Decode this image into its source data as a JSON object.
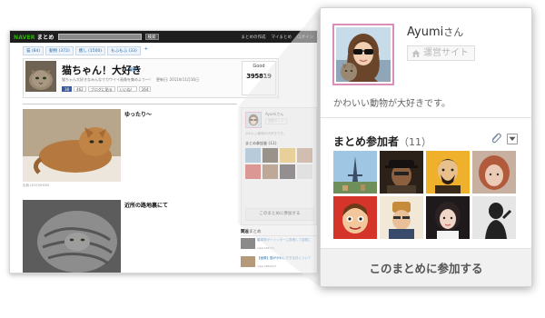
{
  "browser": {
    "logo_brand": "NAVER",
    "logo_service": "まとめ",
    "search_button": "検索",
    "nav_links": [
      "まとめの作成",
      "マイまとめ",
      "ログイン"
    ],
    "tags": [
      "猫 (84)",
      "動物 (372)",
      "癒し (1500)",
      "もふもふ (33)"
    ],
    "tag_add": "+"
  },
  "article": {
    "title": "猫ちゃん！大好き",
    "edit_link": "編集",
    "description": "猫ちゃん大好きなみんなでカワイイ画像を集めよう～！　更新日: 2011年11月16日",
    "share_buttons": [
      "38",
      "462",
      "ブログに貼る",
      "いいね！",
      "164"
    ],
    "good_label": "Good",
    "good_count": "395819",
    "entries": [
      {
        "caption": "ゆったり～",
        "source": "出典 LEGOSHOIN"
      },
      {
        "caption": "近所の路地裏にて"
      }
    ]
  },
  "sidebar_small": {
    "name": "Ayumiさん",
    "site_button": "運営サイト",
    "bio": "かわいい動物が大好きです。",
    "participants": "まとめ参加者 (11)",
    "join": "このまとめに参加する"
  },
  "related": {
    "heading": "関連まとめ",
    "items": [
      {
        "text": "電車男がツイッターに投稿して話題に",
        "meta": "view 164183"
      },
      {
        "text": "【画像】猫がかわいすぎる件について",
        "meta": "view 2660717"
      }
    ]
  },
  "profile": {
    "name": "Ayumi",
    "honorific": "さん",
    "site_button": "運営サイト",
    "bio": "かわいい動物が大好きです。",
    "participants_label": "まとめ参加者",
    "participants_count": "（11）",
    "join_button": "このまとめに参加する",
    "icons": {
      "site": "home-icon",
      "clip": "paperclip-icon",
      "dropdown": "chevron-down-icon"
    },
    "colors": {
      "avatar_border": "#d98fb7",
      "join_text": "#555555"
    }
  }
}
